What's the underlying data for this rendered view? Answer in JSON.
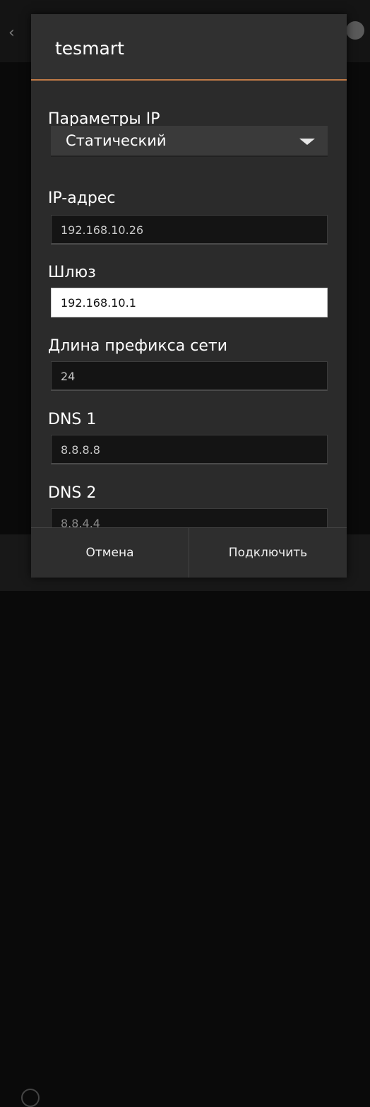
{
  "dialog": {
    "title": "tesmart",
    "ip_settings_label": "Параметры IP",
    "ip_settings_value": "Статический",
    "fields": [
      {
        "label": "IP-адрес",
        "value": "192.168.10.26"
      },
      {
        "label": "Шлюз",
        "value": "192.168.10.1"
      },
      {
        "label": "Длина префикса сети",
        "value": "24"
      },
      {
        "label": "DNS 1",
        "value": "8.8.8.8"
      },
      {
        "label": "DNS 2",
        "value": "8.8.4.4"
      }
    ],
    "cancel_label": "Отмена",
    "connect_label": "Подключить"
  },
  "colors": {
    "accent_divider": "#c07a46",
    "dialog_bg": "#2d2d2d",
    "field_bg": "#141414",
    "active_field_bg": "#ffffff"
  },
  "icons": {
    "spinner": "triangle-down-icon",
    "back": "chevron-left-icon"
  }
}
